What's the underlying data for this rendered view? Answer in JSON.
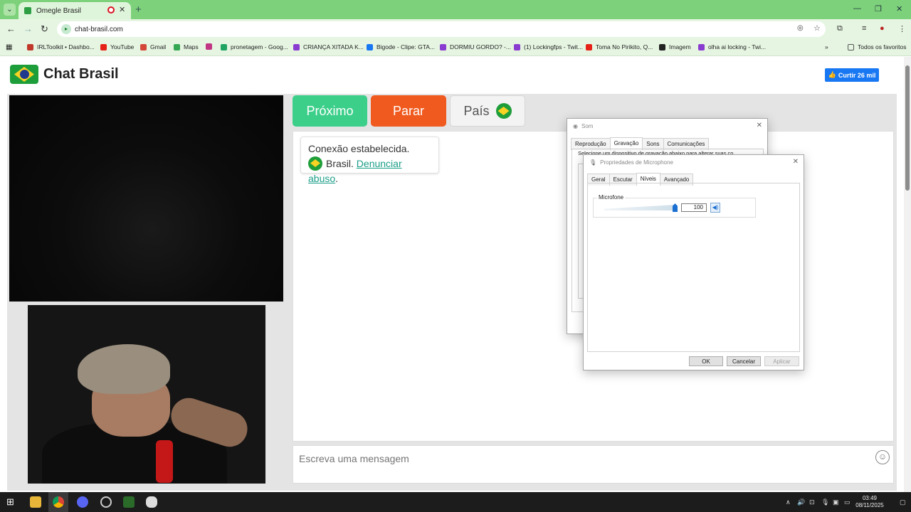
{
  "browser": {
    "tab_title": "Omegle Brasil",
    "tab_close": "✕",
    "new_tab": "+",
    "url": "chat-brasil.com",
    "window_min": "—",
    "window_max": "❐",
    "window_close": "✕",
    "bookmarks": [
      {
        "label": "IRLToolkit • Dashbo...",
        "color": "#c0392b"
      },
      {
        "label": "YouTube",
        "color": "#e62117"
      },
      {
        "label": "Gmail",
        "color": "#d44638"
      },
      {
        "label": "Maps",
        "color": "#34a853"
      },
      {
        "label": "",
        "color": "#c13584"
      },
      {
        "label": "pronetagem - Goog...",
        "color": "#1fa463"
      },
      {
        "label": "CRIANÇA XITADA K...",
        "color": "#8a3cd1"
      },
      {
        "label": "Bigode - Clipe: GTA...",
        "color": "#1877f2"
      },
      {
        "label": "DORMIU GORDO? -...",
        "color": "#8a3cd1"
      },
      {
        "label": "(1) Lockingfps - Twit...",
        "color": "#8a3cd1"
      },
      {
        "label": "Toma No Pirikito, Q...",
        "color": "#e62117"
      },
      {
        "label": "Imagem",
        "color": "#222222"
      },
      {
        "label": "olha ai locking - Twi...",
        "color": "#8a3cd1"
      }
    ],
    "favorites_label": "Todos os favoritos"
  },
  "site": {
    "title": "Chat Brasil",
    "like_label": "Curtir 26 mil",
    "buttons": {
      "next": "Próximo",
      "stop": "Parar",
      "country": "País"
    },
    "chat": {
      "line1": "Conexão estabelecida.",
      "country": "Brasil.",
      "report_link": "Denunciar abuso",
      "period": "."
    },
    "composer_placeholder": "Escreva uma mensagem",
    "emoji": "☺"
  },
  "dialog_som": {
    "title": "Som",
    "tabs": [
      "Reprodução",
      "Gravação",
      "Sons",
      "Comunicações"
    ],
    "active_tab": 1,
    "hint": "Selecione um dispositivo de gravação abaixo para alterar suas co"
  },
  "dialog_mic": {
    "title": "Propriedades de Microphone",
    "tabs": [
      "Geral",
      "Escutar",
      "Níveis",
      "Avançado"
    ],
    "active_tab": 2,
    "group_label": "Microfone",
    "level_value": "100",
    "level_fraction": 1.0,
    "buttons": {
      "ok": "OK",
      "cancel": "Cancelar",
      "apply": "Aplicar"
    }
  },
  "taskbar": {
    "time": "03:49",
    "date": "08/11/2025"
  }
}
